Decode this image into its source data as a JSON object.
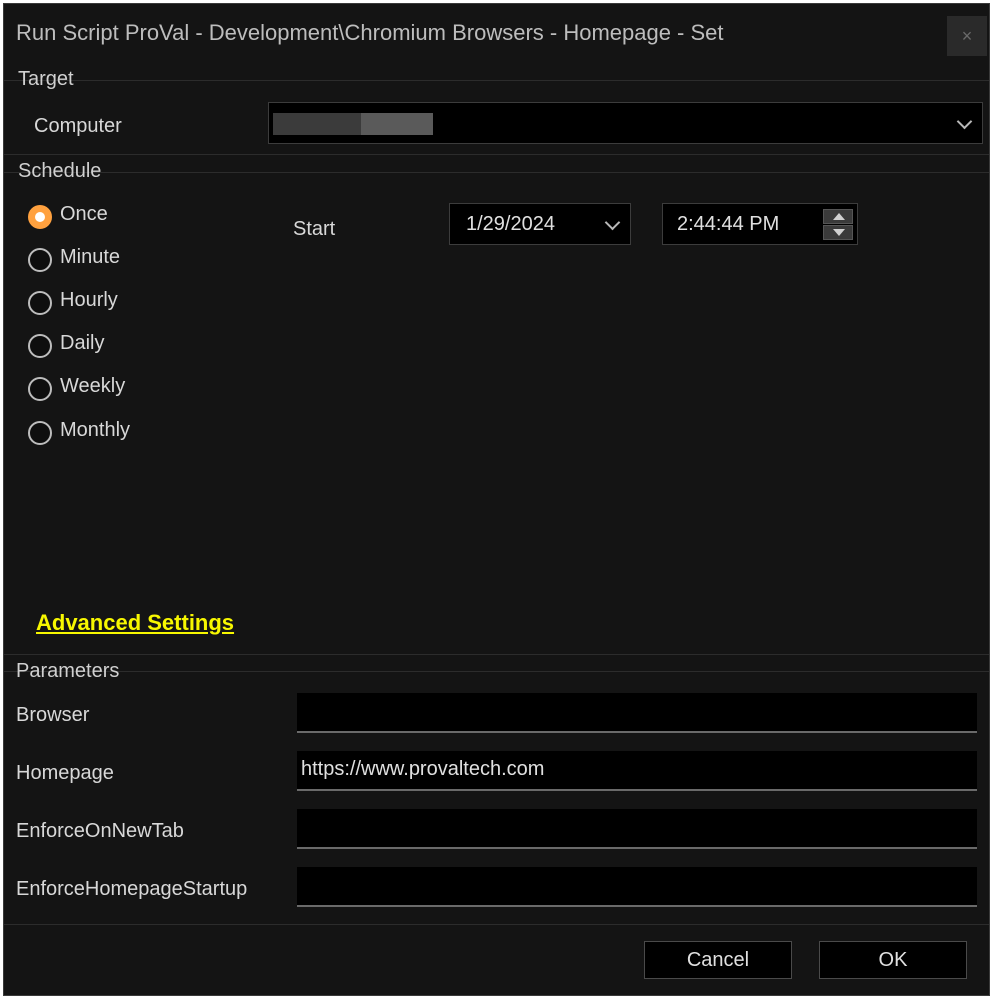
{
  "window": {
    "title": "Run Script ProVal - Development\\Chromium Browsers - Homepage - Set",
    "close_label": "×"
  },
  "target": {
    "section_label": "Target",
    "computer_label": "Computer",
    "computer_value": ""
  },
  "schedule": {
    "section_label": "Schedule",
    "options": [
      {
        "label": "Once",
        "checked": true
      },
      {
        "label": "Minute",
        "checked": false
      },
      {
        "label": "Hourly",
        "checked": false
      },
      {
        "label": "Daily",
        "checked": false
      },
      {
        "label": "Weekly",
        "checked": false
      },
      {
        "label": "Monthly",
        "checked": false
      }
    ],
    "start_label": "Start",
    "start_date": "1/29/2024",
    "start_time": "2:44:44 PM"
  },
  "advanced_settings_label": "Advanced Settings",
  "parameters": {
    "section_label": "Parameters",
    "fields": [
      {
        "label": "Browser",
        "value": ""
      },
      {
        "label": "Homepage",
        "value": "https://www.provaltech.com"
      },
      {
        "label": "EnforceOnNewTab",
        "value": ""
      },
      {
        "label": "EnforceHomepageStartup",
        "value": ""
      }
    ]
  },
  "buttons": {
    "cancel": "Cancel",
    "ok": "OK"
  },
  "colors": {
    "background": "#141414",
    "accent_radio": "#ffa13f",
    "link": "#f7f700"
  }
}
